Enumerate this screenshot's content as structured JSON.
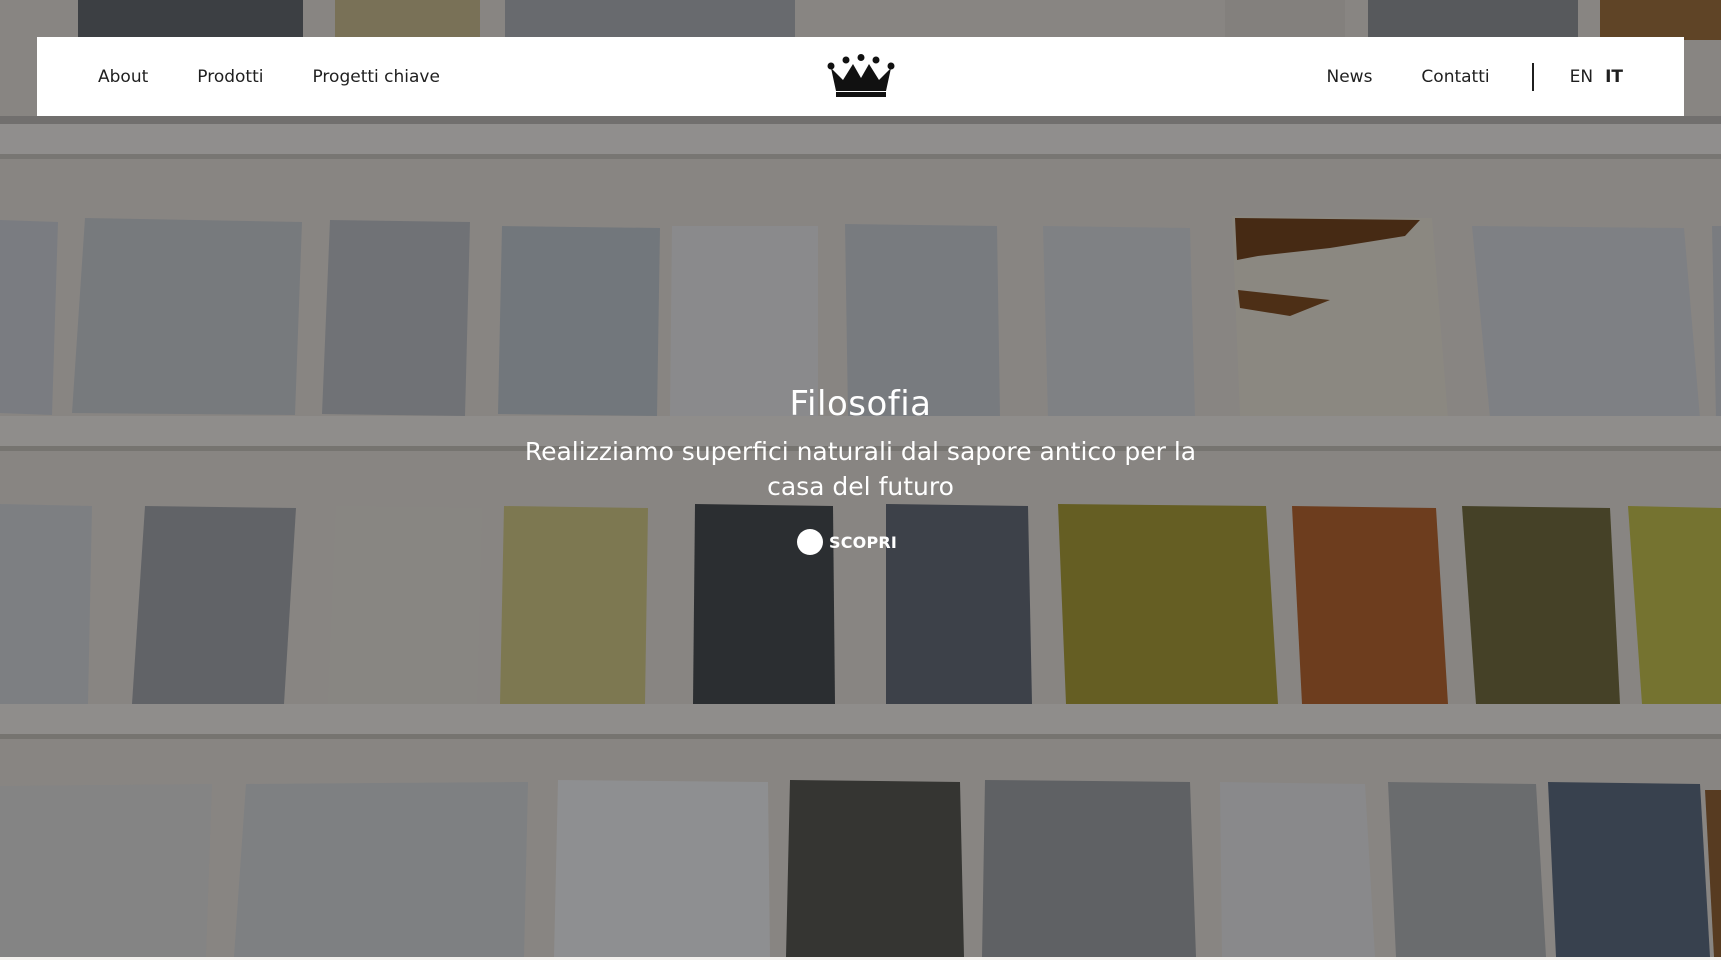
{
  "nav": {
    "left_links": [
      "About",
      "Prodotti",
      "Progetti chiave"
    ],
    "right_links": [
      "News",
      "Contatti"
    ],
    "languages": [
      {
        "code": "EN",
        "active": false
      },
      {
        "code": "IT",
        "active": true
      }
    ],
    "logo_icon": "crown-icon"
  },
  "hero": {
    "title": "Filosofia",
    "subtitle_lines": [
      "Realizziamo superfici naturali dal sapore antico per la",
      "casa del futuro"
    ],
    "cta_label": "SCOPRI",
    "background": "photo of material sample tiles on shelves"
  },
  "colors": {
    "nav_bg": "#ffffff",
    "text_dark": "#1f1f1f",
    "hero_text": "#ffffff"
  }
}
